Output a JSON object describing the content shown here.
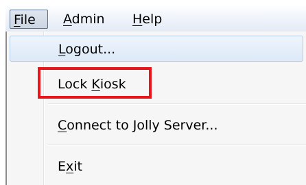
{
  "menubar": {
    "items": [
      {
        "label_underlined": "F",
        "label_rest": "ile"
      },
      {
        "label_underlined": "A",
        "label_rest": "dmin"
      },
      {
        "label_underlined": "H",
        "label_rest": "elp"
      }
    ]
  },
  "file_menu": {
    "items": [
      {
        "label_before": "",
        "label_underlined": "L",
        "label_after": "ogout..."
      },
      {
        "label_before": "Lock ",
        "label_underlined": "K",
        "label_after": "iosk"
      },
      {
        "label_before": "",
        "label_underlined": "C",
        "label_after": "onnect to Jolly Server..."
      },
      {
        "label_before": "E",
        "label_underlined": "x",
        "label_after": "it"
      }
    ]
  },
  "annotation": {
    "color": "#e8161a"
  }
}
